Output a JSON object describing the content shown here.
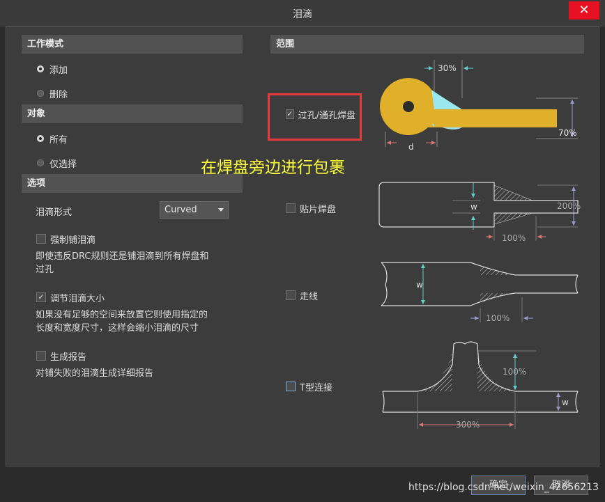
{
  "window": {
    "title": "泪滴",
    "close_glyph": "✕"
  },
  "mode": {
    "header": "工作模式",
    "options": [
      {
        "label": "添加",
        "selected": true
      },
      {
        "label": "删除",
        "selected": false
      }
    ]
  },
  "target": {
    "header": "对象",
    "options": [
      {
        "label": "所有",
        "selected": true
      },
      {
        "label": "仅选择",
        "selected": false
      }
    ]
  },
  "options": {
    "header": "选项",
    "style_label": "泪滴形式",
    "style_value": "Curved",
    "force": {
      "label": "强制铺泪滴",
      "checked": false,
      "desc_line1": "即使违反DRC规则还是铺泪滴到所有焊盘和",
      "desc_line2": "过孔"
    },
    "adjust": {
      "label": "调节泪滴大小",
      "checked": true,
      "desc_line1": "如果没有足够的空间来放置它则使用指定的",
      "desc_line2": "长度和宽度尺寸，这样会缩小泪滴的尺寸"
    },
    "report": {
      "label": "生成报告",
      "checked": false,
      "desc": "对铺失败的泪滴生成详细报告"
    }
  },
  "scope": {
    "header": "范围",
    "via": {
      "label": "过孔/通孔焊盘",
      "checked": true,
      "len_pct": "30%",
      "width_pct": "70%",
      "d_label": "d"
    },
    "smd": {
      "label": "贴片焊盘",
      "checked": false,
      "len_pct": "100%",
      "width_pct": "200%",
      "w_label": "w"
    },
    "track": {
      "label": "走线",
      "checked": false,
      "len_pct": "100%",
      "w_label": "w"
    },
    "tjunction": {
      "label": "T型连接",
      "checked": false,
      "height_pct": "100%",
      "len_pct": "300%",
      "w_label": "w"
    }
  },
  "annotation": "在焊盘旁边进行包裹",
  "buttons": {
    "ok": "确定",
    "cancel": "取消"
  },
  "watermark": "https://blog.csdn.net/weixin_42656213",
  "colors": {
    "pad": "#e0b02a",
    "teardrop": "#9be7f0",
    "annotation": "#ffff3a",
    "highlight": "#e83a3a"
  }
}
